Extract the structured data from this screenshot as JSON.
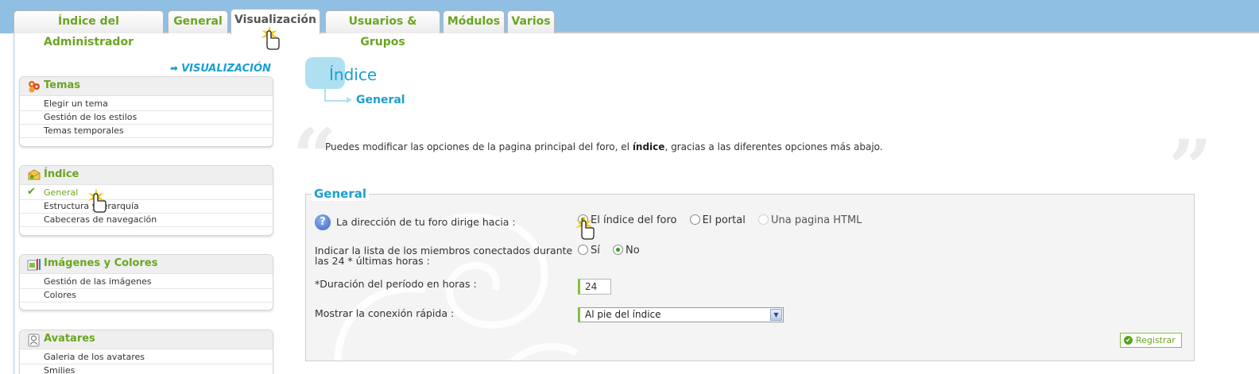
{
  "tabs": [
    {
      "label": "Índice del Administrador"
    },
    {
      "label": "General"
    },
    {
      "label": "Visualización",
      "active": true
    },
    {
      "label": "Usuarios & Grupos"
    },
    {
      "label": "Módulos"
    },
    {
      "label": "Varios"
    }
  ],
  "sidebar": {
    "heading": "VISUALIZACIÓN",
    "sections": [
      {
        "title": "Temas",
        "icon": "palette-icon",
        "items": [
          "Elegir un tema",
          "Gestión de los estilos",
          "Temas temporales"
        ]
      },
      {
        "title": "Índice",
        "icon": "folder-icon",
        "items": [
          "General",
          "Estructura y jerarquía",
          "Cabeceras de navegación"
        ],
        "current": "General"
      },
      {
        "title": "Imágenes y Colores",
        "icon": "images-icon",
        "items": [
          "Gestión de las imágenes",
          "Colores"
        ]
      },
      {
        "title": "Avatares",
        "icon": "avatar-icon",
        "items": [
          "Galeria de los avatares",
          "Smilies"
        ]
      }
    ]
  },
  "main": {
    "title": "Índice",
    "subtitle": "General",
    "intro_before": "Puedes modificar las opciones de la pagina principal del foro, el ",
    "intro_bold": "índice",
    "intro_after": ", gracias a las diferentes opciones más abajo.",
    "open_quote": "“",
    "close_quote": "”",
    "form": {
      "legend": "General",
      "help_icon_glyph": "?",
      "redirect": {
        "label": "La dirección de tu foro dirige hacia :",
        "options": [
          "El índice del foro",
          "El portal",
          "Una pagina HTML"
        ],
        "selected": "El índice del foro"
      },
      "online_list": {
        "label_line1": "Indicar la lista de los miembros conectados durante",
        "label_line2": "las 24 * últimas horas :",
        "options": [
          "Sí",
          "No"
        ],
        "selected": "No"
      },
      "duration": {
        "label": "*Duración del período en horas :",
        "value": "24"
      },
      "quick_login": {
        "label": "Mostrar la conexión rápida :",
        "value": "Al pie del índice"
      },
      "save_label": "Registrar"
    }
  },
  "colors": {
    "accent_green": "#6aa521",
    "accent_blue": "#1b9fd1",
    "topbar_blue": "#8fbfe3"
  }
}
